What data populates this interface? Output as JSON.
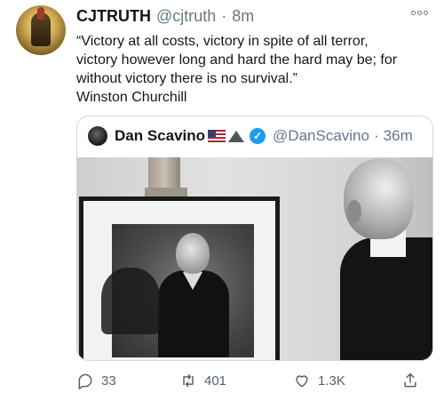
{
  "tweet": {
    "author_name": "CJTRUTH",
    "handle": "@cjtruth",
    "separator": "·",
    "time": "8m",
    "text": "“Victory at all costs, victory in spite of all terror,\nvictory however long and hard the hard may be; for\nwithout victory there is no survival.”\nWinston Churchill"
  },
  "quoted_tweet": {
    "author_name": "Dan Scavino",
    "handle": "@DanScavino",
    "separator": "·",
    "time": "36m",
    "icons": [
      "us-flag-icon",
      "mountain-icon",
      "verified-badge-icon"
    ]
  },
  "actions": {
    "reply_count": "33",
    "retweet_count": "401",
    "like_count": "1.3K"
  },
  "colors": {
    "text": "#14171a",
    "secondary": "#657786",
    "verified": "#1d9bf0",
    "border": "#cfd9de"
  }
}
